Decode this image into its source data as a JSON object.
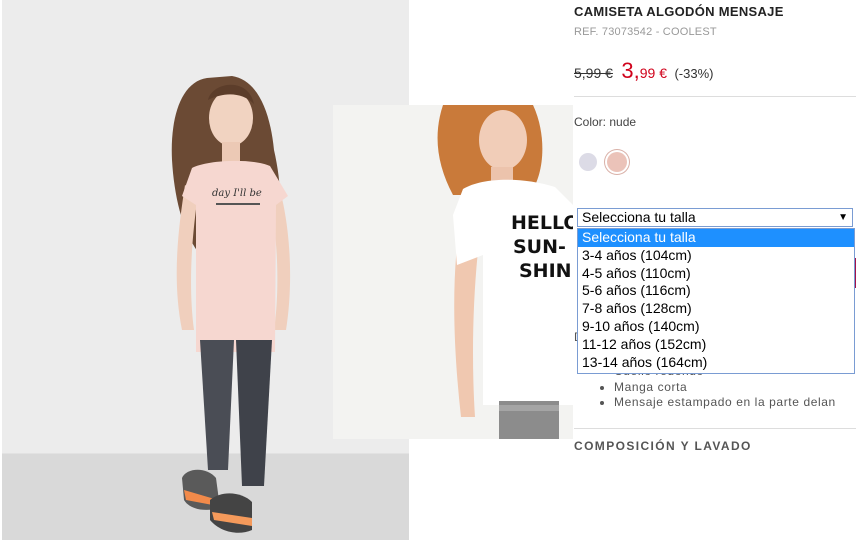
{
  "product": {
    "title": "CAMISETA ALGODÓN MENSAJE",
    "ref": "REF. 73073542 - COOLEST",
    "old_price": "5,99 €",
    "new_price_int": "3,",
    "new_price_dec": "99 €",
    "discount": "(-33%)",
    "color_label": "Color: nude",
    "swatches": [
      {
        "name": "lilac",
        "color": "#dcdbe6"
      },
      {
        "name": "nude",
        "color": "#ebc3b9"
      }
    ],
    "description_partial": "D",
    "features": [
      "Cuello redondo",
      "Manga corta",
      "Mensaje estampado en la parte delan"
    ],
    "composition_title": "COMPOSICIÓN Y LAVADO"
  },
  "size_select": {
    "selected": "Selecciona tu talla",
    "options": [
      "Selecciona tu talla",
      "3-4 años (104cm)",
      "4-5 años (110cm)",
      "5-6 años (116cm)",
      "7-8 años (128cm)",
      "9-10 años (140cm)",
      "11-12 años (152cm)",
      "13-14 años (164cm)"
    ],
    "highlighted_index": 0
  },
  "photos": {
    "main_shirt_print": "day I'll be",
    "second_shirt_print_lines": [
      "HELLO",
      "SUN-",
      "SHINE"
    ]
  },
  "colors": {
    "price_red": "#d0021b",
    "select_highlight": "#1e90ff",
    "select_border": "#7a9cd3",
    "accent_block": "#a3124b"
  }
}
